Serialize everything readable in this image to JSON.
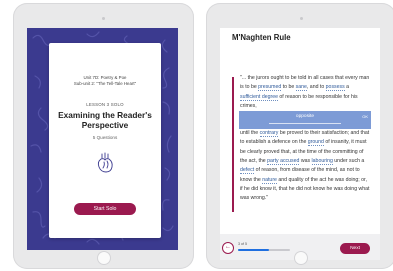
{
  "lesson_intro": {
    "unit": "Unit 7D: Poetry & Poe",
    "subunit": "Sub-unit 2: \"The Tell-Tale Heart\"",
    "lesson_label": "LESSON 3 SOLO",
    "title": "Examining the Reader's Perspective",
    "question_count": "5 Questions",
    "icon": "anatomical-heart-icon",
    "start_button": "Start Solo"
  },
  "reader": {
    "title": "M'Naghten Rule",
    "highlight": {
      "word": "opposite",
      "ok": "OK"
    },
    "progress": {
      "label": "3 of 5",
      "fraction": 0.6
    },
    "back_icon": "arrow-left-icon",
    "next_button": "Next",
    "paragraph": {
      "t1": "\"... the jurors ought to be told in all cases that every man is to be ",
      "l1": "presumed",
      "t2": " to be ",
      "l2": "sane",
      "t3": ", and to ",
      "l3": "possess",
      "t4": " a ",
      "l4": "sufficient degree",
      "t5": " of reason to be responsible for his crimes,",
      "t6": "until the ",
      "l5": "contrary",
      "t7": " be proved to their satisfaction; and that to establish a defence on the ",
      "l6": "ground",
      "t8": " of insanity, it must be clearly proved that, at the time of the committing of the act, the ",
      "l7": "party accused",
      "t9": " was ",
      "l8": "labouring",
      "t10": " under such a ",
      "l9": "defect",
      "t11": " of reason, from disease of the mind, as not to know the ",
      "l10": "nature",
      "t12": " and quality of the act he was doing; or, if he did know it, that he did not know he was doing what was wrong.\""
    }
  },
  "colors": {
    "accent": "#9b1a4f",
    "pattern_bg": "#3b3a8f",
    "highlight": "#7d9bd6",
    "link": "#2f5a9a",
    "progress": "#1f6fe0"
  }
}
